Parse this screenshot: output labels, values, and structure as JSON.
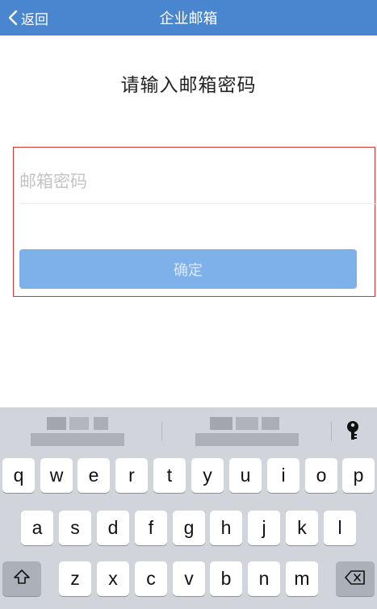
{
  "navbar": {
    "back_label": "返回",
    "title": "企业邮箱",
    "color": "#4a86cf"
  },
  "prompt": "请输入邮箱密码",
  "password_field": {
    "placeholder": "邮箱密码",
    "value": ""
  },
  "confirm_label": "确定",
  "keyboard": {
    "row1": [
      "q",
      "w",
      "e",
      "r",
      "t",
      "y",
      "u",
      "i",
      "o",
      "p"
    ],
    "row2": [
      "a",
      "s",
      "d",
      "f",
      "g",
      "h",
      "j",
      "k",
      "l"
    ],
    "row3": [
      "z",
      "x",
      "c",
      "v",
      "b",
      "n",
      "m"
    ],
    "shift_icon": "shift-icon",
    "delete_icon": "delete-icon",
    "password_icon": "key-icon"
  }
}
